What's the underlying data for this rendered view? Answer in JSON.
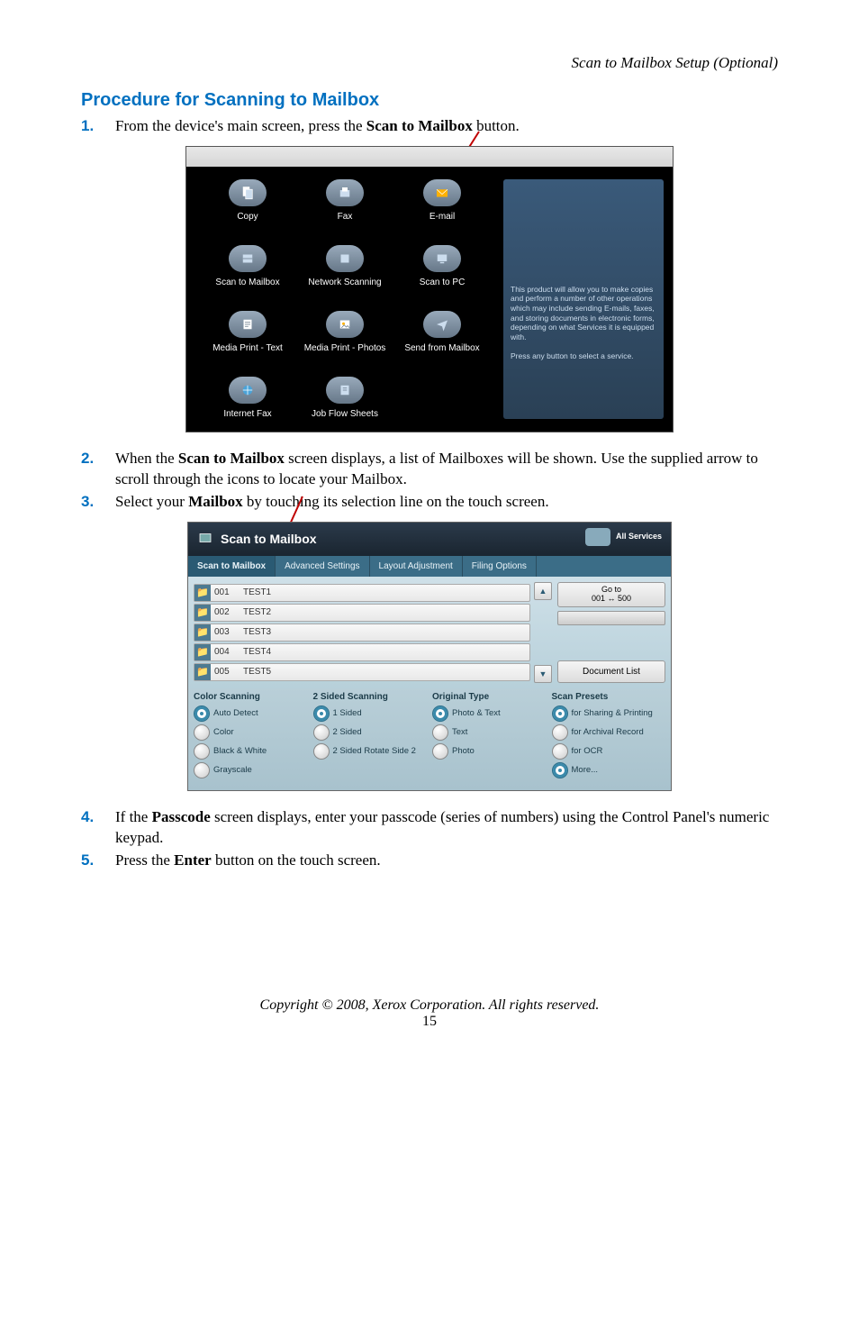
{
  "header": {
    "right": "Scan to Mailbox Setup (Optional)"
  },
  "title": "Procedure for Scanning to Mailbox",
  "steps": {
    "s1": {
      "num": "1.",
      "pre": "From the device's main screen, press the ",
      "bold": "Scan to Mailbox",
      "post": " button."
    },
    "s2": {
      "num": "2.",
      "pre": "When the ",
      "bold": "Scan to Mailbox",
      "post": " screen displays, a list of Mailboxes will be shown. Use the supplied arrow to scroll through the icons to locate your Mailbox."
    },
    "s3": {
      "num": "3.",
      "pre": "Select your ",
      "bold": "Mailbox",
      "post": " by touching its selection line on the touch screen."
    },
    "s4": {
      "num": "4.",
      "pre": "If the ",
      "bold": "Passcode",
      "post": " screen displays, enter your passcode (series of numbers) using the Control Panel's numeric keypad."
    },
    "s5": {
      "num": "5.",
      "pre": "Press the ",
      "bold": "Enter",
      "post": " button on the touch screen."
    }
  },
  "ss1": {
    "items": [
      {
        "label": "Copy"
      },
      {
        "label": "Fax"
      },
      {
        "label": "E-mail"
      },
      {
        "label": "Scan to Mailbox"
      },
      {
        "label": "Network Scanning"
      },
      {
        "label": "Scan to PC"
      },
      {
        "label": "Media Print - Text"
      },
      {
        "label": "Media Print - Photos"
      },
      {
        "label": "Send from Mailbox"
      },
      {
        "label": "Internet Fax"
      },
      {
        "label": "Job Flow Sheets"
      }
    ],
    "panel1": "This product will allow you to make copies and perform a number of other operations which may include sending E-mails, faxes, and storing documents in electronic forms, depending on what Services it is equipped with.",
    "panel2": "Press any button to select a service."
  },
  "ss2": {
    "title": "Scan to Mailbox",
    "all_services": "All Services",
    "tabs": [
      "Scan to Mailbox",
      "Advanced Settings",
      "Layout Adjustment",
      "Filing Options"
    ],
    "mailboxes": [
      {
        "num": "001",
        "name": "TEST1"
      },
      {
        "num": "002",
        "name": "TEST2"
      },
      {
        "num": "003",
        "name": "TEST3"
      },
      {
        "num": "004",
        "name": "TEST4"
      },
      {
        "num": "005",
        "name": "TEST5"
      }
    ],
    "goto_l1": "Go to",
    "goto_l2": "001 ↔ 500",
    "doclist": "Document List",
    "opt_cols": {
      "color": {
        "head": "Color Scanning",
        "items": [
          "Auto Detect",
          "Color",
          "Black & White",
          "Grayscale"
        ]
      },
      "sided": {
        "head": "2 Sided Scanning",
        "items": [
          "1 Sided",
          "2 Sided",
          "2 Sided Rotate Side 2"
        ]
      },
      "otype": {
        "head": "Original Type",
        "items": [
          "Photo & Text",
          "Text",
          "Photo"
        ]
      },
      "presets": {
        "head": "Scan Presets",
        "items": [
          "for Sharing & Printing",
          "for Archival Record",
          "for OCR",
          "More..."
        ]
      }
    }
  },
  "footer": {
    "line": "Copyright © 2008, Xerox Corporation. All rights reserved.",
    "page": "15"
  }
}
